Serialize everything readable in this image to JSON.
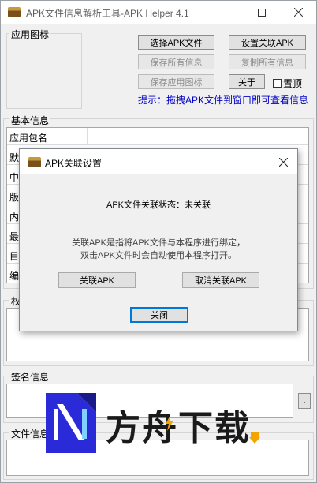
{
  "window": {
    "title": "APK文件信息解析工具-APK Helper 4.1"
  },
  "app_icon_group": {
    "label": "应用图标"
  },
  "toolbar": {
    "select_apk": "选择APK文件",
    "set_association": "设置关联APK",
    "save_all_info": "保存所有信息",
    "copy_all_info": "复制所有信息",
    "save_app_icon": "保存应用图标",
    "about": "关于",
    "topmost_label": "置顶",
    "topmost_checked": false,
    "hint": "提示：拖拽APK文件到窗口即可查看信息"
  },
  "basic_info": {
    "label": "基本信息",
    "rows": [
      {
        "label": "应用包名"
      },
      {
        "label": "默"
      },
      {
        "label": "中"
      },
      {
        "label": "版"
      },
      {
        "label": "内"
      },
      {
        "label": "最"
      },
      {
        "label": "目"
      },
      {
        "label": "编"
      }
    ]
  },
  "permissions": {
    "label": "权"
  },
  "signature": {
    "label": "签名信息",
    "button": "."
  },
  "file_info": {
    "label": "文件信息"
  },
  "dialog": {
    "title": "APK关联设置",
    "status_line": "APK文件关联状态：未关联",
    "description_line1": "关联APK是指将APK文件与本程序进行绑定，",
    "description_line2": "双击APK文件时会自动使用本程序打开。",
    "associate_button": "关联APK",
    "unassociate_button": "取消关联APK",
    "close_button": "关闭"
  },
  "watermark": {
    "text": "方舟下载"
  }
}
